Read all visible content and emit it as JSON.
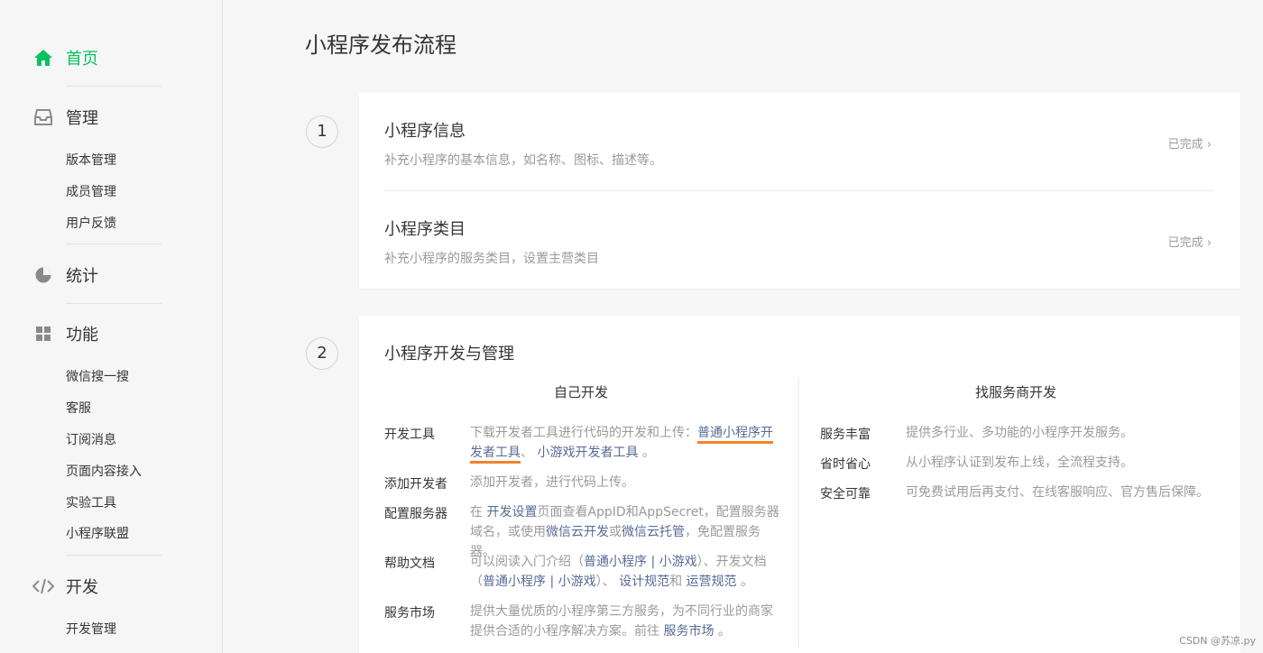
{
  "sidebar": {
    "home": "首页",
    "manage": "管理",
    "manage_items": [
      "版本管理",
      "成员管理",
      "用户反馈"
    ],
    "stats": "统计",
    "features": "功能",
    "feature_items": [
      "微信搜一搜",
      "客服",
      "订阅消息",
      "页面内容接入",
      "实验工具",
      "小程序联盟"
    ],
    "dev": "开发",
    "dev_items": [
      "开发管理"
    ]
  },
  "main": {
    "title": "小程序发布流程",
    "step1": {
      "number": "1",
      "items": [
        {
          "title": "小程序信息",
          "desc": "补充小程序的基本信息，如名称、图标、描述等。",
          "status": "已完成"
        },
        {
          "title": "小程序类目",
          "desc": "补充小程序的服务类目，设置主营类目",
          "status": "已完成"
        }
      ]
    },
    "step2": {
      "number": "2",
      "title": "小程序开发与管理",
      "self_dev": {
        "title": "自己开发",
        "rows": {
          "tools": {
            "label": "开发工具",
            "t1": "下载开发者工具进行代码的开发和上传：",
            "l1a": "普通小程序开",
            "l1b": "发者工具",
            "t2": "、",
            "l2": "小游戏开发者工具",
            "t3": "。"
          },
          "add": {
            "label": "添加开发者",
            "t1": "添加开发者，进行代码上传。"
          },
          "server": {
            "label": "配置服务器",
            "t1": "在",
            "l1": "开发设置",
            "t2": "页面查看AppID和AppSecret，配置服务器域名，或使用",
            "l2": "微信云开发",
            "t3": "或",
            "l3": "微信云托管",
            "t4": "，免配置服务器。"
          },
          "docs": {
            "label": "帮助文档",
            "t1": "可以阅读入门介绍（",
            "l1": "普通小程序 | 小游戏",
            "t2": "）、开发文档（",
            "l2": "普通小程序 | 小游戏",
            "t3": "）、",
            "l3": "设计规范",
            "t4": "和",
            "l4": "运营规范",
            "t5": "。"
          },
          "market": {
            "label": "服务市场",
            "t1": "提供大量优质的小程序第三方服务，为不同行业的商家提供合适的小程序解决方案。前往",
            "l1": "服务市场",
            "t2": "。"
          }
        }
      },
      "provider": {
        "title": "找服务商开发",
        "rows": [
          {
            "label": "服务丰富",
            "text": "提供多行业、多功能的小程序开发服务。"
          },
          {
            "label": "省时省心",
            "text": "从小程序认证到发布上线，全流程支持。"
          },
          {
            "label": "安全可靠",
            "text": "可免费试用后再支付、在线客服响应、官方售后保障。"
          }
        ]
      }
    }
  },
  "watermark": "CSDN @苏凉.py",
  "colors": {
    "accent": "#07c160",
    "link": "#576b95",
    "underline": "#f0842b"
  }
}
